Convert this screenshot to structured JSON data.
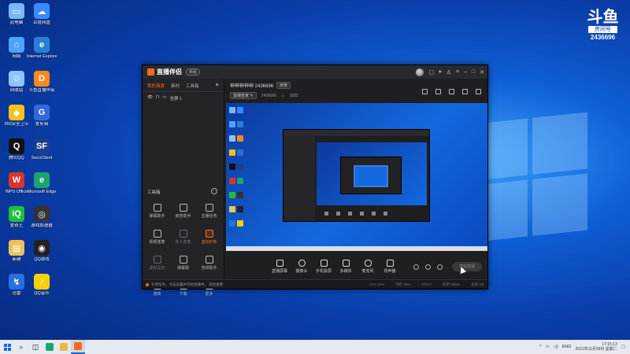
{
  "desktop": {
    "icons": [
      {
        "label": "此电脑",
        "color": "#7ab7ff",
        "glyph": "▭"
      },
      {
        "label": "百度网盘",
        "color": "#3a8bff",
        "glyph": "☁"
      },
      {
        "label": "网络",
        "color": "#4da3ff",
        "glyph": "⌂"
      },
      {
        "label": "Internet Explorer",
        "color": "#2a7fd4",
        "glyph": "e"
      },
      {
        "label": "回收站",
        "color": "#8fc4ff",
        "glyph": "♲"
      },
      {
        "label": "斗鱼直播伴侣",
        "color": "#ff8a1a",
        "glyph": "D"
      },
      {
        "label": "360安全卫士",
        "color": "#f0c419",
        "glyph": "◆"
      },
      {
        "label": "爱剪辑",
        "color": "#2f6ad9",
        "glyph": "G"
      },
      {
        "label": "腾讯QQ",
        "color": "#111",
        "glyph": "Q"
      },
      {
        "label": "SecoClient",
        "color": "#1c3f8c",
        "glyph": "SF"
      },
      {
        "label": "WPS Office",
        "color": "#d9342b",
        "glyph": "W"
      },
      {
        "label": "Microsoft Edge",
        "color": "#1aa36f",
        "glyph": "e"
      },
      {
        "label": "爱奇艺",
        "color": "#1fbf3a",
        "glyph": "iQ"
      },
      {
        "label": "游戏加速器",
        "color": "#333",
        "glyph": "◎"
      },
      {
        "label": "新建",
        "color": "#e8c35a",
        "glyph": "▤"
      },
      {
        "label": "QQ游戏",
        "color": "#222",
        "glyph": "◉"
      },
      {
        "label": "迅雷",
        "color": "#2a6fe0",
        "glyph": "↯"
      },
      {
        "label": "QQ音乐",
        "color": "#f5d200",
        "glyph": "♪"
      }
    ]
  },
  "badge": {
    "logo": "斗鱼",
    "room_label": "房间号",
    "room_number": "2436696"
  },
  "app": {
    "title": "直播伴侣",
    "version": "新版",
    "tabs": [
      "我的场景",
      "素材",
      "工具箱"
    ],
    "scene": "全屏 1",
    "room_name": "神神神神神 2436696",
    "room_tag": "房管",
    "row2_label": "直播管家",
    "row2_id": "2436696",
    "fans": "1082",
    "toolbox_title": "工具箱",
    "tools": [
      {
        "label": "弹幕助手",
        "state": ""
      },
      {
        "label": "房管助手",
        "state": ""
      },
      {
        "label": "主播任务",
        "state": ""
      },
      {
        "label": "视频连麦",
        "state": ""
      },
      {
        "label": "多人连麦",
        "state": "dim"
      },
      {
        "label": "虚拟形象",
        "state": "hl"
      },
      {
        "label": "虚拟互动",
        "state": "dim"
      },
      {
        "label": "弹幕姬",
        "state": ""
      },
      {
        "label": "音频助手",
        "state": ""
      },
      {
        "label": "游戏",
        "state": ""
      },
      {
        "label": "下载",
        "state": ""
      },
      {
        "label": "更多",
        "state": ""
      }
    ],
    "controls": [
      "直播屏幕",
      "摄像头",
      "手机投屏",
      "多媒体",
      "麦克风",
      "扬声器"
    ],
    "start_button": "开始直播",
    "status_text": "礼物任务，点击设置并开始直播中。 前往查看",
    "stats": [
      "CPU 12%",
      "内存 38%",
      "FPS 0",
      "码率 0kbps",
      "丢帧 0%"
    ]
  },
  "taskbar": {
    "lang": "ENG",
    "time": "17:15:13",
    "date": "2021年11月09日 星期二"
  }
}
